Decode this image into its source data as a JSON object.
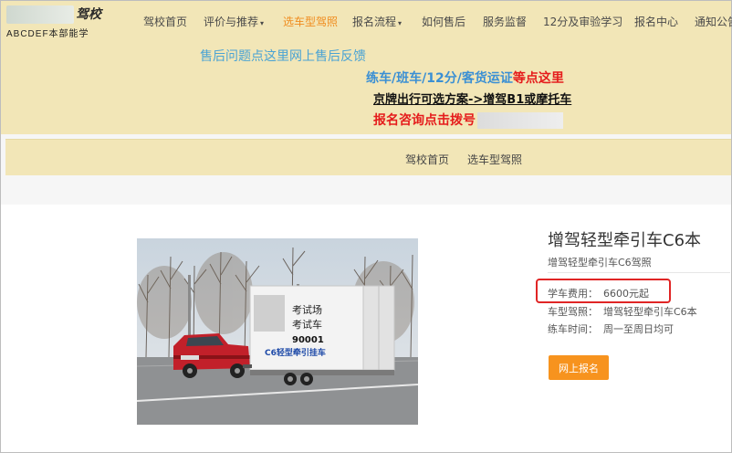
{
  "logo": {
    "script_text": "驾校",
    "sub_text": "ABCDEF本部能学"
  },
  "nav": {
    "items": [
      {
        "label": "驾校首页",
        "dropdown": false,
        "active": false
      },
      {
        "label": "评价与推荐",
        "dropdown": true,
        "active": false
      },
      {
        "label": "选车型驾照",
        "dropdown": false,
        "active": true
      },
      {
        "label": "报名流程",
        "dropdown": true,
        "active": false
      },
      {
        "label": "如何售后",
        "dropdown": false,
        "active": false
      },
      {
        "label": "服务监督",
        "dropdown": false,
        "active": false
      },
      {
        "label": "12分及审验学习",
        "dropdown": false,
        "active": false
      },
      {
        "label": "报名中心",
        "dropdown": false,
        "active": false
      },
      {
        "label": "通知公告",
        "dropdown": false,
        "active": false
      }
    ],
    "caret": "▾",
    "active_color": "#f08c1e"
  },
  "banner": {
    "line1": "售后问题点这里网上售后反馈",
    "line2_blue": "练车/班车/12分/客货运证",
    "line2_red": "等点这里",
    "line3": "京牌出行可选方案->增驾B1或摩托车",
    "line4": "报名咨询点击拨号"
  },
  "breadcrumb": {
    "home": "驾校首页",
    "current": "选车型驾照"
  },
  "product": {
    "title": "增驾轻型牵引车C6本",
    "subtitle": "增驾轻型牵引车C6驾照",
    "fee_label": "学车费用：",
    "fee_value": "6600元起",
    "type_label": "车型驾照：",
    "type_value": "增驾轻型牵引车C6本",
    "time_label": "练车时间：",
    "time_value": "周一至周日均可",
    "button": "网上报名"
  },
  "photo": {
    "trailer_text_1": "考试场",
    "trailer_text_2": "考试车",
    "trailer_number": "90001",
    "trailer_caption": "C6轻型牵引挂车"
  },
  "colors": {
    "nav_bg": "#f2e6b7",
    "accent_orange": "#f7931e",
    "highlight_red": "#e02525"
  }
}
